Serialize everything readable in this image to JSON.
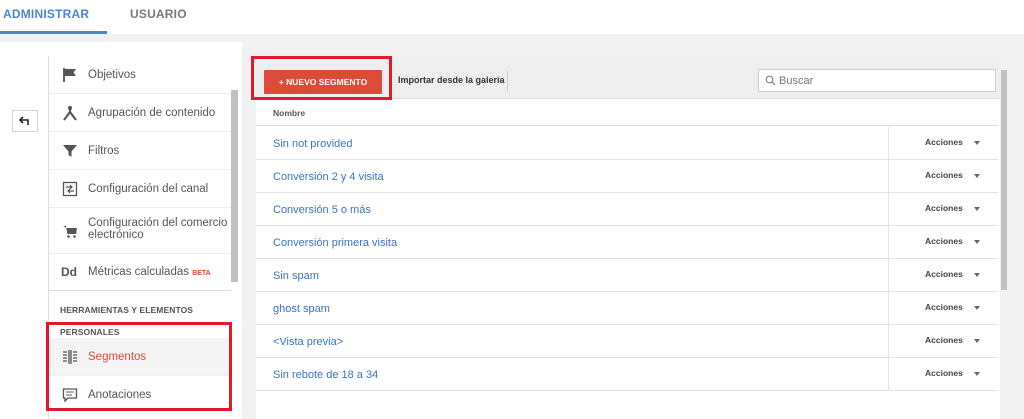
{
  "tabs": [
    {
      "label": "ADMINISTRAR"
    },
    {
      "label": "USUARIO"
    }
  ],
  "sidebar": {
    "items": [
      {
        "label": "Objetivos",
        "icon": "flag-icon"
      },
      {
        "label": "Agrupación de contenido",
        "icon": "grouping-icon"
      },
      {
        "label": "Filtros",
        "icon": "filter-icon"
      },
      {
        "label": "Configuración del canal",
        "icon": "channel-icon"
      },
      {
        "label_line1": "Configuración del comercio",
        "label_line2": "electrónico",
        "icon": "cart-icon"
      },
      {
        "label": "Métricas calculadas",
        "badge": "BETA",
        "icon_text": "Dd"
      }
    ],
    "section_tools": "HERRAMIENTAS Y ELEMENTOS",
    "section_personal": "PERSONALES",
    "personal_items": [
      {
        "label": "Segmentos",
        "icon": "segments-icon"
      },
      {
        "label": "Anotaciones",
        "icon": "annotations-icon"
      }
    ]
  },
  "toolbar": {
    "new_segment_label": "+ NUEVO SEGMENTO",
    "import_label": "Importar desde la galería",
    "search_placeholder": "Buscar"
  },
  "table": {
    "column_name": "Nombre",
    "actions_label": "Acciones",
    "rows": [
      "Sin not provided",
      "Conversión 2 y 4 visita",
      "Conversión 5 o más",
      "Conversión primera visita",
      "Sin spam",
      "ghost spam",
      "<Vista previa>",
      "Sin rebote de 18 a 34"
    ]
  },
  "colors": {
    "accent_blue": "#4a86c9",
    "new_button_red": "#dc4a38",
    "link_blue": "#3b73c0",
    "highlight_red": "#e01a2b"
  }
}
